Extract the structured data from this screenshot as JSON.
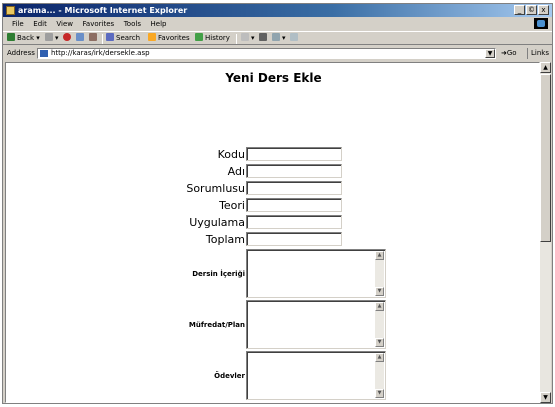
{
  "window": {
    "title": "arama... - Microsoft Internet Explorer",
    "controls": {
      "minimize": "_",
      "maximize": "©",
      "close": "x"
    }
  },
  "menu": [
    "File",
    "Edit",
    "View",
    "Favorites",
    "Tools",
    "Help"
  ],
  "toolbar": {
    "back": "Back",
    "search": "Search",
    "favorites": "Favorites",
    "history": "History"
  },
  "address": {
    "label": "Address",
    "url": "http://karas/irk/dersekle.asp",
    "go": "Go",
    "links": "Links"
  },
  "page": {
    "title": "Yeni Ders Ekle",
    "fields": [
      {
        "label": "Kodu",
        "value": ""
      },
      {
        "label": "Adı",
        "value": ""
      },
      {
        "label": "Sorumlusu",
        "value": ""
      },
      {
        "label": "Teori",
        "value": ""
      },
      {
        "label": "Uygulama",
        "value": ""
      },
      {
        "label": "Toplam",
        "value": ""
      }
    ],
    "textareas": [
      {
        "label": "Dersin İçeriği",
        "value": ""
      },
      {
        "label": "Müfredat/Plan",
        "value": ""
      },
      {
        "label": "Ödevler",
        "value": ""
      }
    ]
  },
  "colors": {
    "titlebar_start": "#0a246a",
    "titlebar_end": "#a6caf0",
    "chrome": "#d4d0c8"
  }
}
